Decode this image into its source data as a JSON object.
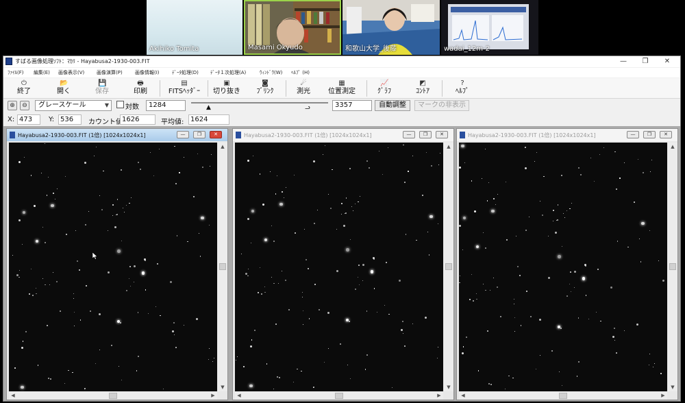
{
  "participants": [
    {
      "name": "Akihiko Tomita"
    },
    {
      "name": "Masami Okyudo"
    },
    {
      "name": "和歌山大学_後藤"
    },
    {
      "name": "wadai_12m-2"
    }
  ],
  "window": {
    "title": "すばる画像処理ｿﾌﾄ：ﾏｶﾘ - Hayabusa2-1930-003.FIT",
    "minimize": "—",
    "maximize": "❐",
    "close": "✕"
  },
  "menu": [
    "ﾌｧｲﾙ(F)",
    "編集(E)",
    "画像表示(V)",
    "画像演算(P)",
    "画像情報(I)",
    "ﾃﾞｰﾀ処理(D)",
    "ﾃﾞｰﾀ１次処理(A)",
    "ｳｨﾝﾄﾞｳ(W)",
    "ﾍﾙﾌﾟ (H)"
  ],
  "toolbar": [
    {
      "label": "終了",
      "icon": "power-icon",
      "glyph": "⏻",
      "enabled": true
    },
    {
      "label": "開く",
      "icon": "open-folder-icon",
      "glyph": "📂",
      "enabled": true
    },
    {
      "label": "保存",
      "icon": "save-icon",
      "glyph": "💾",
      "enabled": false
    },
    {
      "label": "印刷",
      "icon": "print-icon",
      "glyph": "🖶",
      "enabled": true
    },
    {
      "label": "FITSﾍｯﾀﾞｰ",
      "icon": "fits-header-icon",
      "glyph": "▤",
      "enabled": true
    },
    {
      "label": "切り抜き",
      "icon": "crop-icon",
      "glyph": "▣",
      "enabled": true
    },
    {
      "label": "ﾌﾞﾘﾝｸ",
      "icon": "blink-icon",
      "glyph": "◙",
      "enabled": true
    },
    {
      "label": "測光",
      "icon": "photometry-icon",
      "glyph": "☄",
      "enabled": true
    },
    {
      "label": "位置測定",
      "icon": "astrometry-icon",
      "glyph": "▦",
      "enabled": true
    },
    {
      "label": "ｸﾞﾗﾌ",
      "icon": "graph-icon",
      "glyph": "📈",
      "enabled": true
    },
    {
      "label": "ｺﾝﾄｱ",
      "icon": "contour-icon",
      "glyph": "◩",
      "enabled": true
    },
    {
      "label": "ﾍﾙﾌﾟ",
      "icon": "help-icon",
      "glyph": "?",
      "enabled": true
    }
  ],
  "controls": {
    "zoom_in": "⊕",
    "zoom_out": "⊖",
    "scale_mode": "グレースケール",
    "log_scale_label": "対数",
    "log_scale_checked": false,
    "min_level": "1284",
    "max_level": "3357",
    "auto_adjust": "自動調整",
    "hide_marks": "マークの非表示"
  },
  "status": {
    "x_label": "X:",
    "x": "473",
    "y_label": "Y:",
    "y": "536",
    "count_label": "カウント値:",
    "count": "1626",
    "mean_label": "平均値:",
    "mean": "1624"
  },
  "image_windows": [
    {
      "title": "Hayabusa2-1930-003.FIT (1倍) [1024x1024x1]",
      "active": true
    },
    {
      "title": "Hayabusa2-1930-003.FIT (1倍) [1024x1024x1]",
      "active": false
    },
    {
      "title": "Hayabusa2-1930-003.FIT (1倍) [1024x1024x1]",
      "active": false
    }
  ],
  "colors": {
    "active_title": "#a9cbea",
    "sky_background": "#0b0b0b",
    "star": "#ffffff",
    "speaker_border": "#9bd24a"
  }
}
